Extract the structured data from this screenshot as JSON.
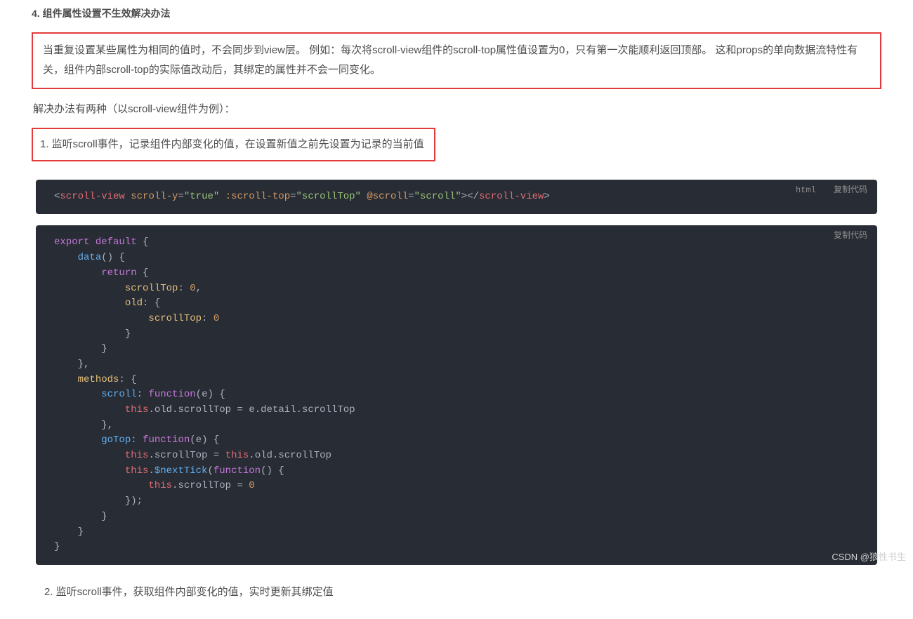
{
  "heading": "4. 组件属性设置不生效解决办法",
  "boxed_paragraph": "当重复设置某些属性为相同的值时，不会同步到view层。 例如：每次将scroll-view组件的scroll-top属性值设置为0，只有第一次能顺利返回顶部。 这和props的单向数据流特性有关，组件内部scroll-top的实际值改动后，其绑定的属性并不会一同变化。",
  "intro_line": "解决办法有两种（以scroll-view组件为例）：",
  "step1": "1. 监听scroll事件，记录组件内部变化的值，在设置新值之前先设置为记录的当前值",
  "code1": {
    "lang": "html",
    "copy": "复制代码",
    "tokens": {
      "open": "<",
      "tag": "scroll-view",
      "a1": "scroll-y",
      "v1": "\"true\"",
      "a2": ":scroll-top",
      "v2": "\"scrollTop\"",
      "a3": "@scroll",
      "v3": "\"scroll\"",
      "closeOpen": "></",
      "close": ">"
    }
  },
  "code2": {
    "copy": "复制代码",
    "kw_export": "export",
    "kw_default": "default",
    "fn_data": "data",
    "kw_return": "return",
    "prop_scrollTop": "scrollTop",
    "num_zero": "0",
    "prop_old": "old",
    "prop_methods": "methods",
    "prop_scroll": "scroll",
    "kw_function": "function",
    "param_e": "e",
    "kw_this": "this",
    "dot_old": "old",
    "dot_scrollTop": "scrollTop",
    "eq": " = ",
    "e_detail": "detail",
    "prop_goTop": "goTop",
    "fn_nextTick": "$nextTick"
  },
  "step2": "2. 监听scroll事件，获取组件内部变化的值，实时更新其绑定值",
  "watermark": "CSDN @狼性书生"
}
